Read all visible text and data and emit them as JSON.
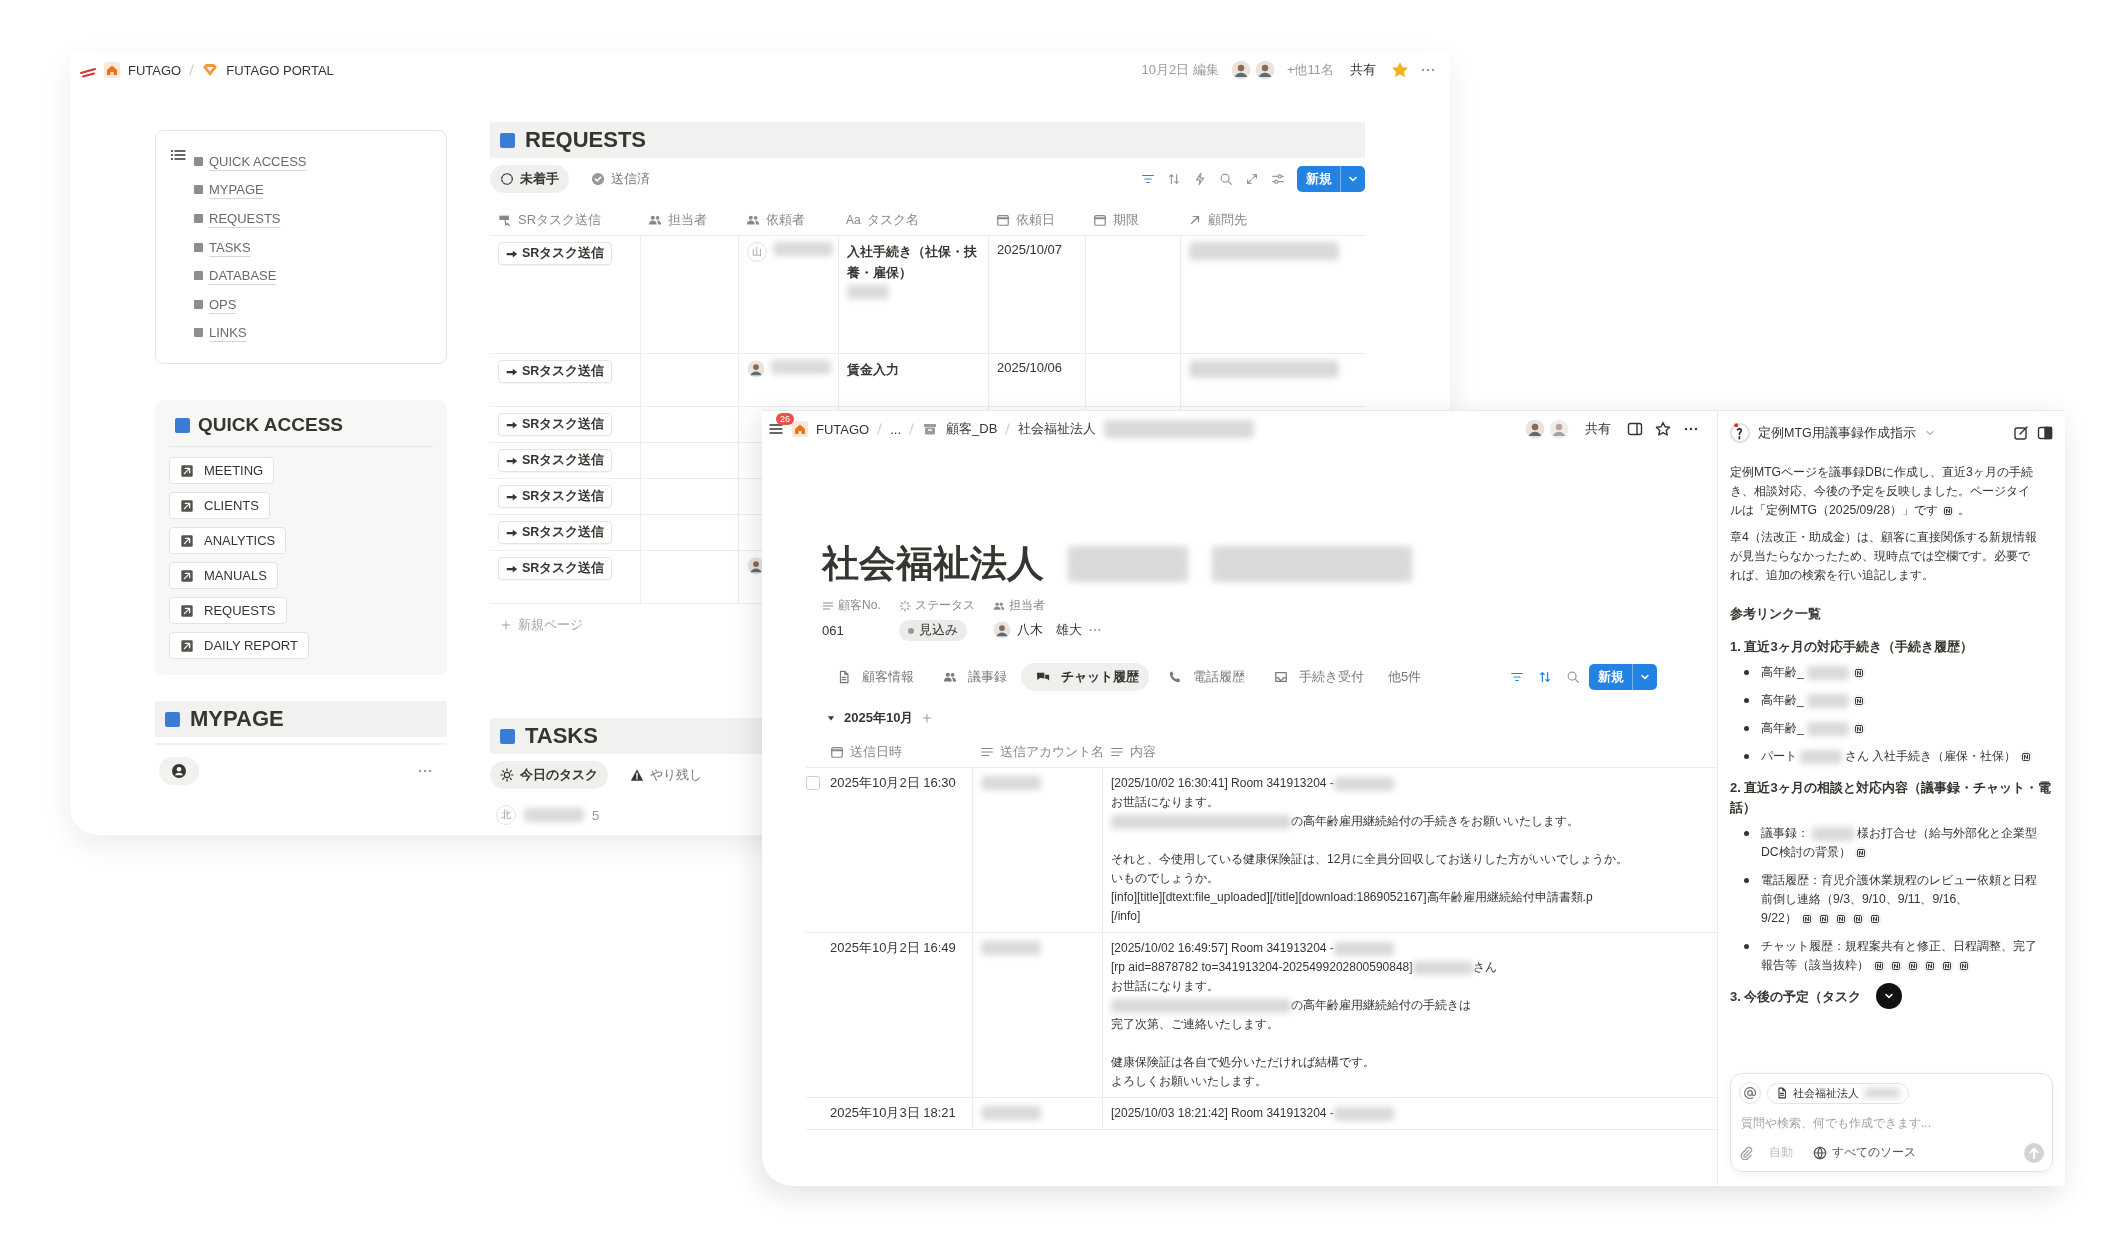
{
  "back_window": {
    "breadcrumb": [
      "FUTAGO",
      "FUTAGO PORTAL"
    ],
    "edited": "10月2日 編集",
    "others": "+他11名",
    "share": "共有",
    "toc": [
      "QUICK ACCESS",
      "MYPAGE",
      "REQUESTS",
      "TASKS",
      "DATABASE",
      "OPS",
      "LINKS"
    ],
    "quick_access": {
      "title": "QUICK ACCESS",
      "links": [
        "MEETING",
        "CLIENTS",
        "ANALYTICS",
        "MANUALS",
        "REQUESTS",
        "DAILY REPORT"
      ]
    },
    "mypage": {
      "title": "MYPAGE"
    },
    "requests": {
      "title": "REQUESTS",
      "tabs": [
        {
          "label": "未着手",
          "kind": "pending",
          "selected": true
        },
        {
          "label": "送信済",
          "kind": "done",
          "selected": false
        }
      ],
      "new_button": "新規",
      "columns": [
        {
          "label": "SRタスク送信",
          "kind": "button"
        },
        {
          "label": "担当者",
          "kind": "person"
        },
        {
          "label": "依頼者",
          "kind": "person"
        },
        {
          "label": "タスク名",
          "kind": "title",
          "type_mark": "Aa"
        },
        {
          "label": "依頼日",
          "kind": "date"
        },
        {
          "label": "期限",
          "kind": "date"
        },
        {
          "label": "顧問先",
          "kind": "relation"
        }
      ],
      "rows": [
        {
          "action": "SRタスク送信",
          "requester": {
            "kind": "letter",
            "text": "山"
          },
          "task": "入社手続き（社保・扶養・雇保）",
          "task_blurred": true,
          "date": "2025/10/07",
          "client_blurred": true
        },
        {
          "action": "SRタスク送信",
          "requester": {
            "kind": "photo"
          },
          "task": "賃金入力",
          "task_blurred": false,
          "date": "2025/10/06",
          "client_blurred": true
        },
        {
          "action": "SRタスク送信",
          "requester": {
            "kind": "none"
          },
          "task_blurred": false,
          "client_blurred": false
        },
        {
          "action": "SRタスク送信",
          "requester": {
            "kind": "none"
          },
          "task_blurred": false,
          "client_blurred": false
        },
        {
          "action": "SRタスク送信",
          "requester": {
            "kind": "none"
          },
          "task_blurred": false,
          "client_blurred": false
        },
        {
          "action": "SRタスク送信",
          "requester": {
            "kind": "none"
          },
          "task_blurred": false,
          "client_blurred": false
        },
        {
          "action": "SRタスク送信",
          "requester": {
            "kind": "photo"
          },
          "task_blurred": false,
          "client_blurred": false
        }
      ],
      "new_page": "新規ページ"
    },
    "tasks": {
      "title": "TASKS",
      "tabs": [
        {
          "label": "今日のタスク",
          "kind": "sun",
          "selected": true
        },
        {
          "label": "やり残し",
          "kind": "warning",
          "selected": false
        }
      ],
      "group": {
        "badge": "北",
        "count": "5"
      }
    }
  },
  "front_window": {
    "badge": "26",
    "breadcrumb": [
      {
        "kind": "home",
        "label": "FUTAGO"
      },
      {
        "kind": "plain",
        "label": "..."
      },
      {
        "kind": "database",
        "label": "顧客_DB"
      },
      {
        "kind": "plain",
        "label": "社会福祉法人"
      }
    ],
    "share": "共有",
    "title": "社会福祉法人",
    "properties": [
      {
        "label": "顧客No.",
        "kind": "text",
        "value": "061"
      },
      {
        "label": "ステータス",
        "kind": "status",
        "value": "見込み"
      },
      {
        "label": "担当者",
        "kind": "person",
        "value": "八木　雄大"
      }
    ],
    "views": [
      {
        "label": "顧客情報",
        "kind": "page",
        "selected": false
      },
      {
        "label": "議事録",
        "kind": "people",
        "selected": false
      },
      {
        "label": "チャット履歴",
        "kind": "chat",
        "selected": true
      },
      {
        "label": "電話履歴",
        "kind": "phone",
        "selected": false
      },
      {
        "label": "手続き受付",
        "kind": "inbox",
        "selected": false
      }
    ],
    "more_views": "他5件",
    "new_button": "新規",
    "group": "2025年10月",
    "columns": [
      "送信日時",
      "送信アカウント名",
      "内容"
    ],
    "rows": [
      {
        "date": "2025年10月2日 16:30",
        "checked": false,
        "lines": [
          {
            "kind": "text",
            "segments": [
              {
                "kind": "text",
                "text": "[2025/10/02 16:30:41] Room 341913204 -"
              },
              {
                "kind": "blur"
              }
            ]
          },
          {
            "kind": "text",
            "segments": [
              {
                "kind": "text",
                "text": "お世話になります。"
              }
            ]
          },
          {
            "kind": "text",
            "segments": [
              {
                "kind": "blur_long"
              },
              {
                "kind": "text",
                "text": "の高年齢雇用継続給付の手続きをお願いいたします。"
              }
            ]
          },
          {
            "kind": "blank"
          },
          {
            "kind": "text",
            "segments": [
              {
                "kind": "text",
                "text": "それと、今使用している健康保険証は、12月に全員分回収してお送りした方がいいでしょうか。"
              }
            ]
          },
          {
            "kind": "text",
            "segments": [
              {
                "kind": "text",
                "text": "いものでしょうか。"
              }
            ]
          },
          {
            "kind": "text",
            "segments": [
              {
                "kind": "text",
                "text": "[info][title][dtext:file_uploaded][/title][download:1869052167]高年齢雇用継続給付申請書類.p"
              }
            ]
          },
          {
            "kind": "text",
            "segments": [
              {
                "kind": "text",
                "text": "[/info]"
              }
            ]
          }
        ]
      },
      {
        "date": "2025年10月2日 16:49",
        "lines": [
          {
            "kind": "text",
            "segments": [
              {
                "kind": "text",
                "text": "[2025/10/02 16:49:57] Room 341913204 -"
              },
              {
                "kind": "blur"
              }
            ]
          },
          {
            "kind": "text",
            "segments": [
              {
                "kind": "text",
                "text": "[rp aid=8878782 to=341913204-2025499202800590848]"
              },
              {
                "kind": "blur"
              },
              {
                "kind": "text",
                "text": "さん"
              }
            ]
          },
          {
            "kind": "text",
            "segments": [
              {
                "kind": "text",
                "text": "お世話になります。"
              }
            ]
          },
          {
            "kind": "text",
            "segments": [
              {
                "kind": "blur_long"
              },
              {
                "kind": "text",
                "text": "の高年齢雇用継続給付の手続きは"
              }
            ]
          },
          {
            "kind": "text",
            "segments": [
              {
                "kind": "text",
                "text": "完了次第、ご連絡いたします。"
              }
            ]
          },
          {
            "kind": "blank"
          },
          {
            "kind": "text",
            "segments": [
              {
                "kind": "text",
                "text": "健康保険証は各自で処分いただければ結構です。"
              }
            ]
          },
          {
            "kind": "text",
            "segments": [
              {
                "kind": "text",
                "text": "よろしくお願いいたします。"
              }
            ]
          }
        ]
      },
      {
        "date": "2025年10月3日 18:21",
        "lines": [
          {
            "kind": "text",
            "segments": [
              {
                "kind": "text",
                "text": "[2025/10/03 18:21:42] Room 341913204 -"
              },
              {
                "kind": "blur"
              }
            ]
          }
        ]
      }
    ]
  },
  "ai_panel": {
    "title": "定例MTG用議事録作成指示",
    "blocks": [
      {
        "kind": "paragraph",
        "lines": [
          [
            {
              "kind": "text",
              "text": "定例MTGページを議事録DBに作成し、直近3ヶ月の手続"
            }
          ],
          [
            {
              "kind": "text",
              "text": "き、相談対応、今後の予定を反映しました。ページタイ"
            }
          ],
          [
            {
              "kind": "text",
              "text": "ルは「定例MTG（2025/09/28）」です"
            },
            {
              "kind": "link"
            },
            {
              "kind": "text",
              "text": "。"
            }
          ]
        ]
      },
      {
        "kind": "paragraph",
        "lines": [
          [
            {
              "kind": "text",
              "text": "章4（法改正・助成金）は、顧客に直接関係する新規情報"
            }
          ],
          [
            {
              "kind": "text",
              "text": "が見当たらなかったため、現時点では空欄です。必要で"
            }
          ],
          [
            {
              "kind": "text",
              "text": "れば、追加の検索を行い追記します。"
            }
          ]
        ]
      },
      {
        "kind": "heading",
        "text": "参考リンク一覧"
      },
      {
        "kind": "subheading",
        "text": "1. 直近3ヶ月の対応手続き（手続き履歴）"
      },
      {
        "kind": "bullets",
        "items": [
          [
            [
              {
                "kind": "text",
                "text": "高年齢_"
              },
              {
                "kind": "blur"
              },
              {
                "kind": "link"
              }
            ]
          ],
          [
            [
              {
                "kind": "text",
                "text": "高年齢_"
              },
              {
                "kind": "blur"
              },
              {
                "kind": "link"
              }
            ]
          ],
          [
            [
              {
                "kind": "text",
                "text": "高年齢_"
              },
              {
                "kind": "blur"
              },
              {
                "kind": "link"
              }
            ]
          ],
          [
            [
              {
                "kind": "text",
                "text": "パート"
              },
              {
                "kind": "blur"
              },
              {
                "kind": "text",
                "text": "さん 入社手続き（雇保・社保）"
              },
              {
                "kind": "link"
              }
            ]
          ]
        ]
      },
      {
        "kind": "subheading",
        "text": "2. 直近3ヶ月の相談と対応内容（議事録・チャット・電話）"
      },
      {
        "kind": "bullets",
        "items": [
          [
            [
              {
                "kind": "text",
                "text": "議事録："
              },
              {
                "kind": "blur"
              },
              {
                "kind": "text",
                "text": "様お打合せ（給与外部化と企業型"
              }
            ],
            [
              {
                "kind": "text",
                "text": "DC検討の背景）"
              },
              {
                "kind": "link"
              }
            ]
          ],
          [
            [
              {
                "kind": "text",
                "text": "電話履歴：育児介護休業規程のレビュー依頼と日程"
              }
            ],
            [
              {
                "kind": "text",
                "text": "前倒し連絡（9/3、9/10、9/11、9/16、"
              }
            ],
            [
              {
                "kind": "text",
                "text": "9/22）"
              },
              {
                "kind": "link"
              },
              {
                "kind": "link"
              },
              {
                "kind": "link"
              },
              {
                "kind": "link"
              },
              {
                "kind": "link"
              }
            ]
          ],
          [
            [
              {
                "kind": "text",
                "text": "チャット履歴：規程案共有と修正、日程調整、完了"
              }
            ],
            [
              {
                "kind": "text",
                "text": "報告等（該当抜粋）"
              },
              {
                "kind": "link"
              },
              {
                "kind": "link"
              },
              {
                "kind": "link"
              },
              {
                "kind": "link"
              },
              {
                "kind": "link"
              },
              {
                "kind": "link"
              }
            ]
          ]
        ]
      },
      {
        "kind": "subheading",
        "text": "3. 今後の予定（タスク"
      }
    ],
    "context_chip": "社会福祉法人",
    "placeholder": "質問や検索、何でも作成できます...",
    "mode": "自動",
    "sources": "すべてのソース"
  }
}
